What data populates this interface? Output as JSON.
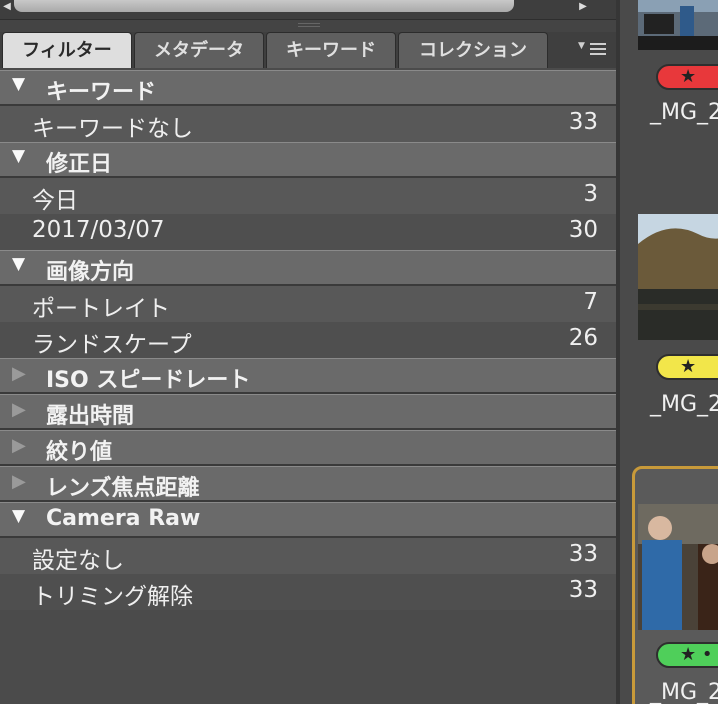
{
  "scroll": {
    "left_arrow": "◀",
    "right_arrow": "▶"
  },
  "tabs": [
    {
      "label": "フィルター",
      "active": true
    },
    {
      "label": "メタデータ",
      "active": false
    },
    {
      "label": "キーワード",
      "active": false
    },
    {
      "label": "コレクション",
      "active": false
    }
  ],
  "tab_menu_icon": "panel-menu-icon",
  "sections": [
    {
      "title": "キーワード",
      "expanded": true,
      "items": [
        {
          "label": "キーワードなし",
          "count": "33"
        }
      ]
    },
    {
      "title": "修正日",
      "expanded": true,
      "items": [
        {
          "label": "今日",
          "count": "3"
        },
        {
          "label": "2017/03/07",
          "count": "30"
        }
      ]
    },
    {
      "title": "画像方向",
      "expanded": true,
      "items": [
        {
          "label": "ポートレイト",
          "count": "7"
        },
        {
          "label": "ランドスケープ",
          "count": "26"
        }
      ]
    },
    {
      "title": "ISO スピードレート",
      "expanded": false,
      "items": []
    },
    {
      "title": "露出時間",
      "expanded": false,
      "items": []
    },
    {
      "title": "絞り値",
      "expanded": false,
      "items": []
    },
    {
      "title": "レンズ焦点距離",
      "expanded": false,
      "items": []
    },
    {
      "title": "Camera Raw",
      "expanded": true,
      "items": [
        {
          "label": "設定なし",
          "count": "33"
        },
        {
          "label": "トリミング解除",
          "count": "33"
        }
      ]
    }
  ],
  "arrows": {
    "expanded": "▼",
    "collapsed": "▶"
  },
  "thumbnails": [
    {
      "filename": "_MG_2",
      "rating": "★",
      "label_color": "#e8383b"
    },
    {
      "filename": "_MG_2",
      "rating": "★",
      "label_color": "#f2e64a"
    },
    {
      "filename": "_MG_2",
      "rating": "★ •",
      "label_color": "#4fcf5a",
      "selected": true
    }
  ],
  "colors": {
    "selection_border": "#c89a3a"
  }
}
